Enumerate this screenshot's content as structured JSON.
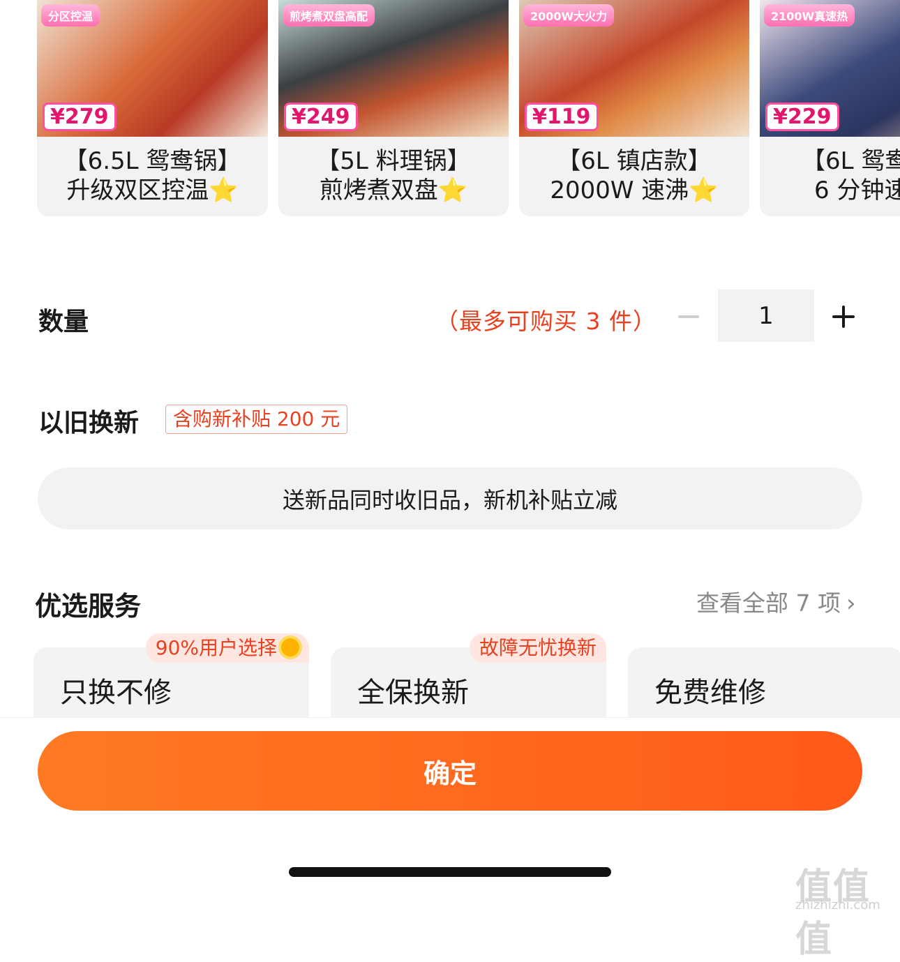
{
  "variants": [
    {
      "label_line1": "【6.5L 鸳鸯锅】",
      "label_line2": "升级双区控温⭐",
      "price": "¥279",
      "promo": "分区控温"
    },
    {
      "label_line1": "【5L 料理锅】",
      "label_line2": "煎烤煮双盘⭐",
      "price": "¥249",
      "promo": "煎烤煮双盘高配"
    },
    {
      "label_line1": "【6L 镇店款】",
      "label_line2": "2000W 速沸⭐",
      "price": "¥119",
      "promo": "2000W大火力"
    },
    {
      "label_line1": "【6L 鸳鸯",
      "label_line2": "6 分钟速",
      "price": "¥229",
      "promo": "2100W真速热"
    }
  ],
  "quantity": {
    "title": "数量",
    "limit": "（最多可购买 3 件）",
    "value": "1"
  },
  "trade_in": {
    "title": "以旧换新",
    "tag": "含购新补贴 200 元",
    "description": "送新品同时收旧品，新机补贴立减"
  },
  "services": {
    "title": "优选服务",
    "view_all": "查看全部 7 项",
    "items": [
      {
        "name": "只换不修",
        "badge": "90%用户选择"
      },
      {
        "name": "全保换新",
        "badge": "故障无忧换新"
      },
      {
        "name": "免费维修",
        "badge": ""
      }
    ]
  },
  "confirm_label": "确定",
  "watermark": {
    "title": "值值值",
    "sub": "zhizhizhi.com"
  },
  "colors": {
    "accent": "#ff6a1f",
    "warning_text": "#e8411f"
  }
}
